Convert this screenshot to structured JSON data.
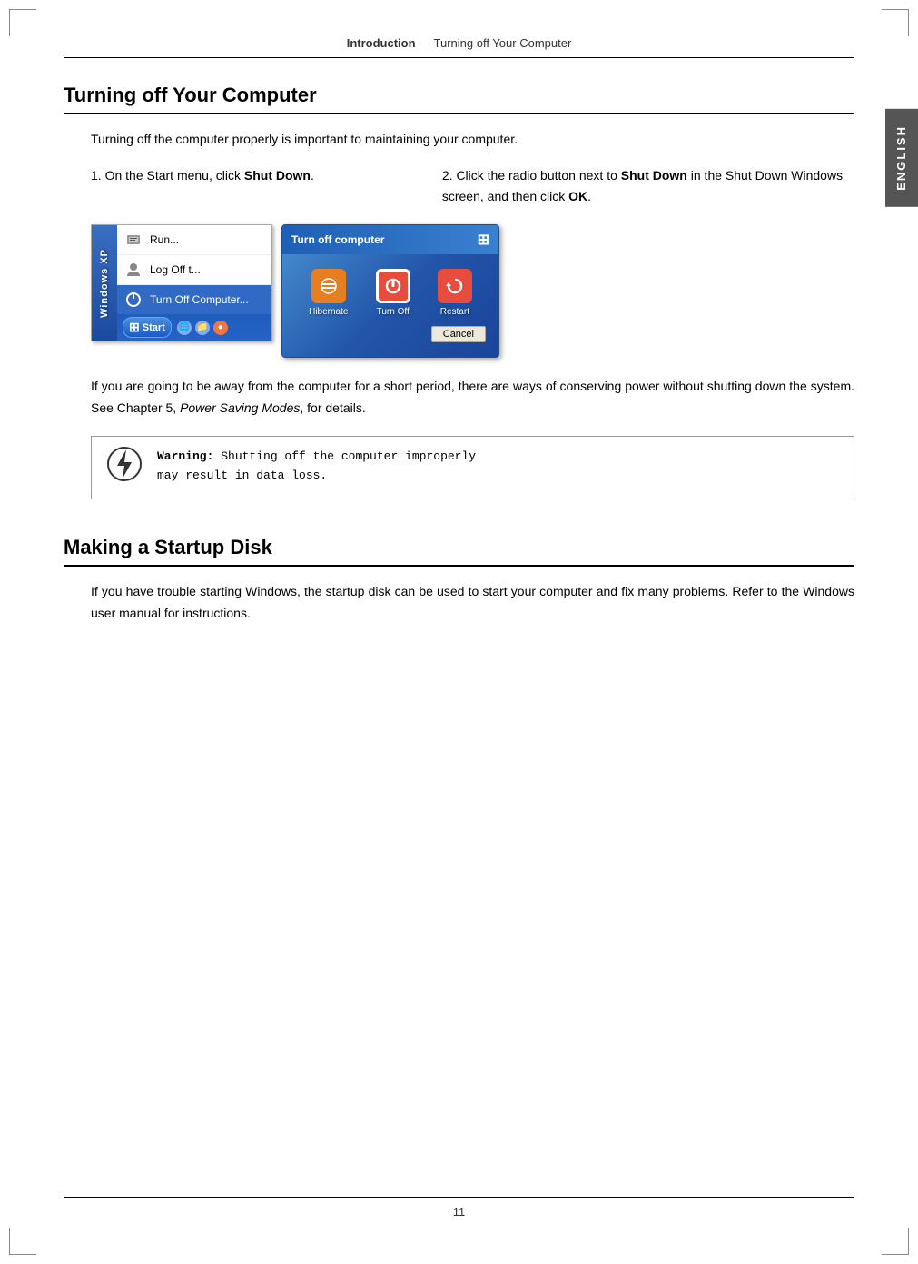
{
  "page": {
    "number": "11",
    "header": {
      "bold_part": "Introduction",
      "rest": " — Turning off Your Computer"
    }
  },
  "side_tab": {
    "label": "ENGLISH"
  },
  "section1": {
    "title": "Turning off Your Computer",
    "intro": "Turning off the computer properly is important to maintaining your computer.",
    "step1": {
      "number": "1.",
      "text": "On the Start menu, click ",
      "bold": "Shut Down",
      "rest": "."
    },
    "step2": {
      "number": "2.",
      "text": "Click the radio button next to ",
      "bold1": "Shut Down",
      "middle": " in the Shut Down Windows screen, and then click ",
      "bold2": "OK",
      "end": "."
    },
    "start_menu": {
      "sidebar_text": "Windows XP",
      "item1": "Run...",
      "item2": "Log Off t...",
      "item3": "Turn Off Computer...",
      "start_label": "Start"
    },
    "turnoff_dialog": {
      "title": "Turn off computer",
      "option1": "Hibernate",
      "option2": "Turn Off",
      "option3": "Restart",
      "cancel": "Cancel"
    },
    "para2": "If you are going to be away from the computer for a short period, there are ways of conserving power without shutting down the system. See Chapter 5, Power Saving Modes, for details.",
    "para2_italic": "Power Saving Modes",
    "warning": {
      "label": "Warning:",
      "text": " Shutting off the computer improperly\nmay result in data loss."
    }
  },
  "section2": {
    "title": "Making a Startup Disk",
    "para": "If you have trouble starting Windows, the startup disk can be used to start your computer and fix many problems. Refer to the Windows user manual for instructions."
  }
}
